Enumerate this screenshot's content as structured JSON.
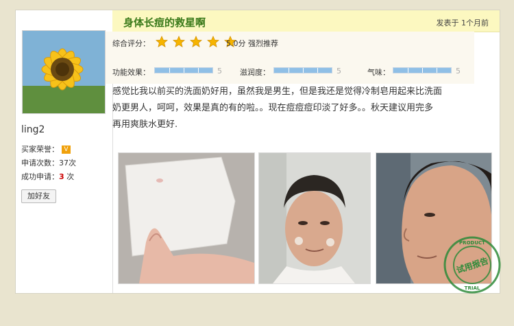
{
  "user": {
    "name": "ling2",
    "honor_label": "买家荣誉：",
    "honor_badge": "V",
    "apply_count_label": "申请次数：37次",
    "success_label": "成功申请：",
    "success_count": "3",
    "success_unit": "次",
    "add_friend": "加好友"
  },
  "review": {
    "title": "身体长痘的救星啊",
    "posted": "发表于  1个月前",
    "overall_label": "综合评分：",
    "overall_score": "5.0分",
    "overall_verdict": "强烈推荐",
    "stars": 5,
    "metrics": [
      {
        "label": "功能效果：",
        "value": "5",
        "fraction": 1.0
      },
      {
        "label": "滋润度：",
        "value": "5",
        "fraction": 1.0
      },
      {
        "label": "气味：",
        "value": "5",
        "fraction": 1.0
      }
    ],
    "body_line1": "感觉比我以前买的洗面奶好用，虽然我是男生，但是我还是觉得冷制皂用起来比洗面",
    "body_line2": "奶更男人，呵呵，效果是真的有的啦。。现在痘痘痘印淡了好多。。秋天建议用完多",
    "body_line3": "再用爽肤水更好."
  },
  "stamp": {
    "center_text": "试用报告",
    "ring_top": "PRODUCT",
    "ring_bottom": "TRIAL"
  },
  "colors": {
    "title_green": "#3a7a1a",
    "header_yellow": "#fcf8c0",
    "star_gold": "#f6b400",
    "bar_blue": "#8fbfe6",
    "stamp_green": "#2e8b3a"
  }
}
